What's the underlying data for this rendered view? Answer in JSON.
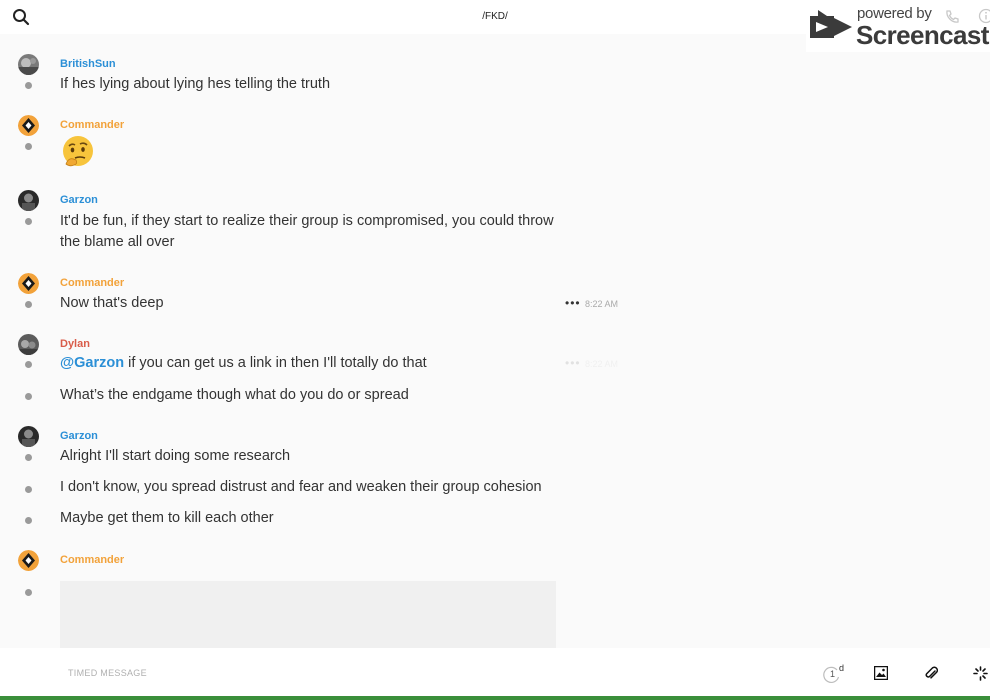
{
  "header": {
    "title": "/FKD/"
  },
  "watermark": {
    "powered_by": "powered by",
    "brand": "Screencastify"
  },
  "colors": {
    "blue_name": "#2b8fd6",
    "orange_name": "#f2a23a",
    "red_name": "#d95c4a",
    "dot": "#9a9a9a"
  },
  "messages": [
    {
      "author": "BritishSun",
      "text": "If hes lying about lying hes telling the truth"
    },
    {
      "author": "Commander",
      "emoji": "thinking-face"
    },
    {
      "author": "Garzon",
      "text": "It'd be fun, if they start to realize their group is compromised, you could throw the blame all over"
    },
    {
      "author": "Commander",
      "text": "Now that's deep",
      "time": "8:22 AM"
    },
    {
      "author": "Dylan",
      "mention": "@Garzon",
      "text": " if you can get us a link in then I'll totally do that",
      "time": "8:22 AM"
    },
    {
      "text": "What’s the endgame though what do you do or spread"
    },
    {
      "author": "Garzon",
      "text": "Alright I'll start doing some research"
    },
    {
      "text": "I don't know, you spread distrust and fear and weaken their group cohesion"
    },
    {
      "text": "Maybe get them to kill each other"
    },
    {
      "author": "Commander"
    }
  ],
  "composer": {
    "placeholder": "TIMED MESSAGE",
    "timer_count": "1",
    "timer_unit": "d"
  }
}
